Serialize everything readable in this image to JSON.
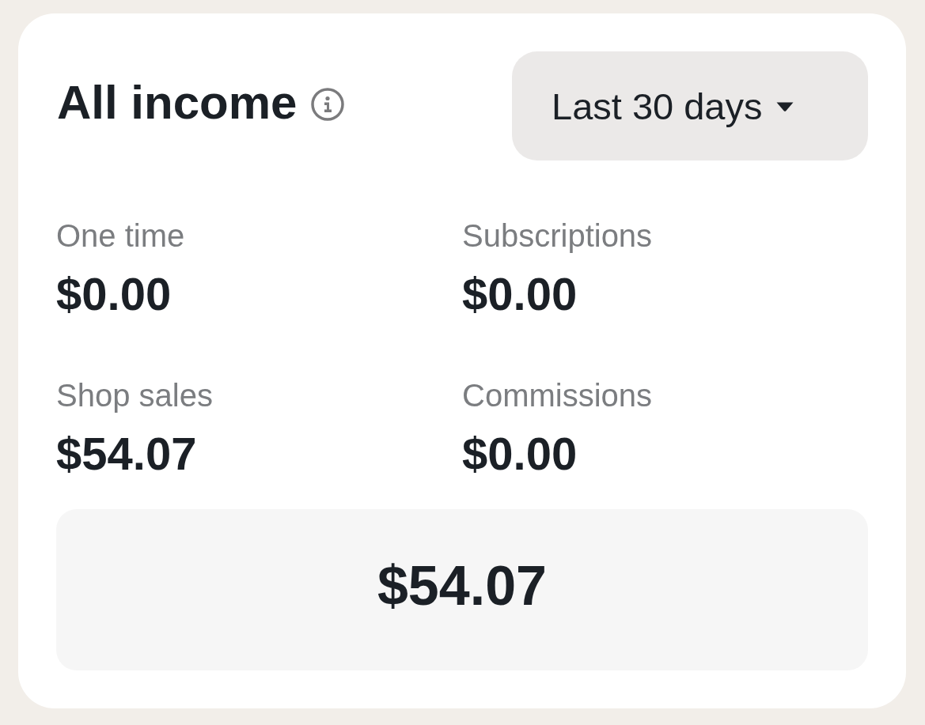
{
  "header": {
    "title": "All income",
    "period_select": {
      "value": "Last 30 days"
    }
  },
  "stats": [
    {
      "label": "One time",
      "value": "$0.00"
    },
    {
      "label": "Subscriptions",
      "value": "$0.00"
    },
    {
      "label": "Shop sales",
      "value": "$54.07"
    },
    {
      "label": "Commissions",
      "value": "$0.00"
    }
  ],
  "total": {
    "value": "$54.07"
  }
}
